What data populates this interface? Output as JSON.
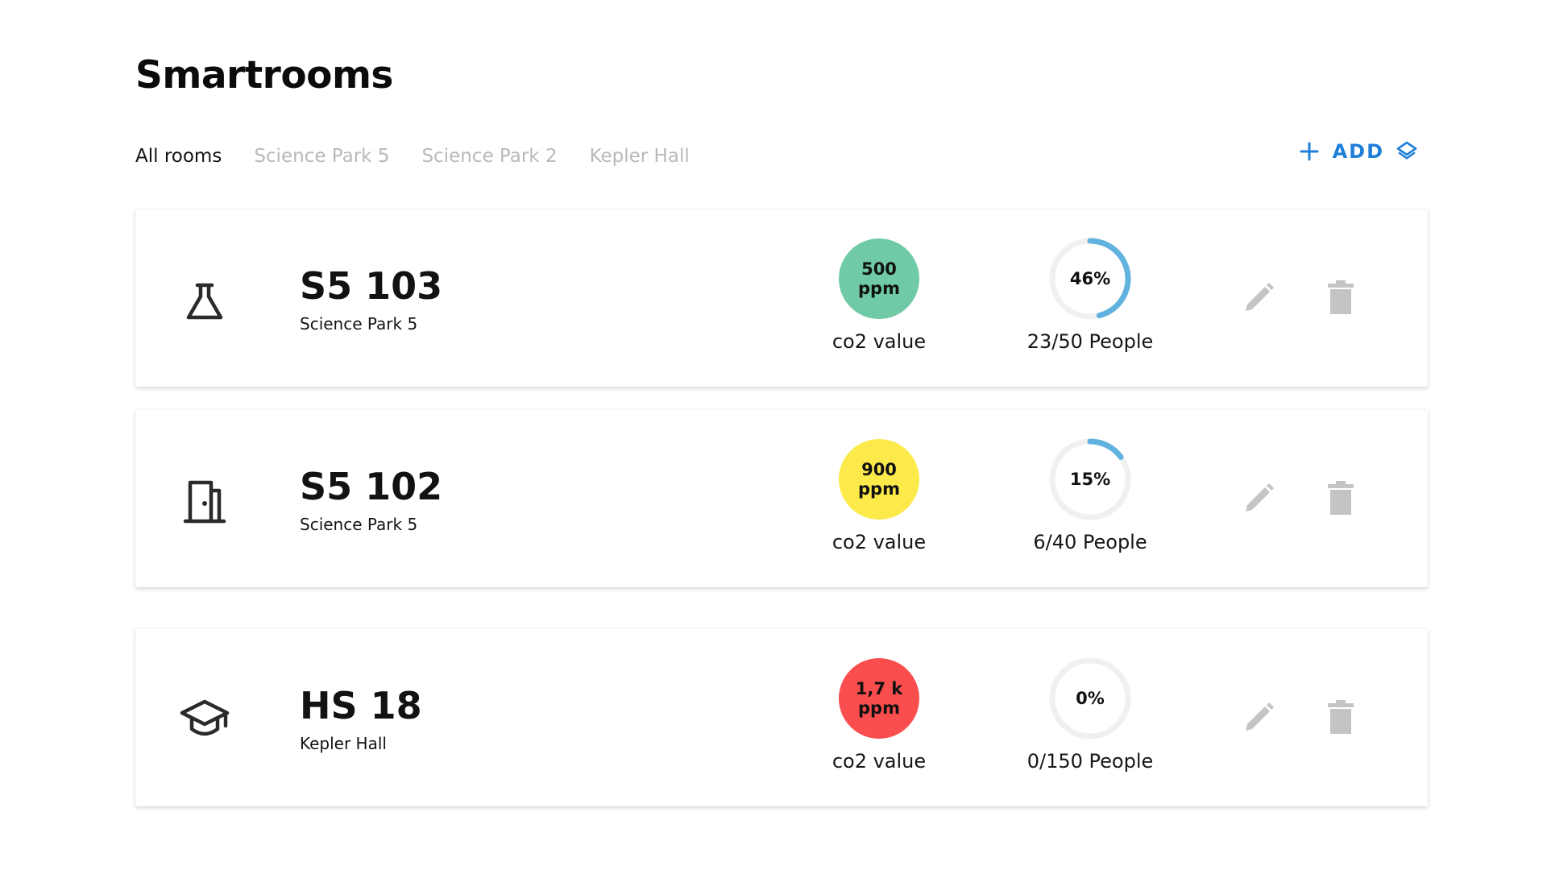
{
  "page": {
    "title": "Smartrooms"
  },
  "tabs": [
    {
      "label": "All rooms",
      "active": true
    },
    {
      "label": "Science Park 5",
      "active": false
    },
    {
      "label": "Science Park 2",
      "active": false
    },
    {
      "label": "Kepler Hall",
      "active": false
    }
  ],
  "toolbar": {
    "add_label": "ADD",
    "add_icon": "plus-icon",
    "layers_icon": "layers-icon",
    "accent_color": "#1f7fd8"
  },
  "rooms": [
    {
      "icon": "flask-icon",
      "name": "S5 103",
      "location": "Science Park 5",
      "co2": {
        "value": "500",
        "unit": "ppm",
        "label": "co2 value",
        "color": "#6fcaa5"
      },
      "occupancy": {
        "percent_text": "46%",
        "fraction": 0.46,
        "label": "23/50 People"
      },
      "actions": {
        "edit_icon": "pencil-icon",
        "delete_icon": "trash-icon"
      }
    },
    {
      "icon": "door-icon",
      "name": "S5 102",
      "location": "Science Park 5",
      "co2": {
        "value": "900",
        "unit": "ppm",
        "label": "co2 value",
        "color": "#fcea4a"
      },
      "occupancy": {
        "percent_text": "15%",
        "fraction": 0.15,
        "label": "6/40 People"
      },
      "actions": {
        "edit_icon": "pencil-icon",
        "delete_icon": "trash-icon"
      }
    },
    {
      "icon": "graduation-cap-icon",
      "name": "HS 18",
      "location": "Kepler Hall",
      "co2": {
        "value": "1,7 k",
        "unit": "ppm",
        "label": "co2 value",
        "color": "#fa4d4d"
      },
      "occupancy": {
        "percent_text": "0%",
        "fraction": 0.0,
        "label": "0/150 People"
      },
      "actions": {
        "edit_icon": "pencil-icon",
        "delete_icon": "trash-icon"
      }
    }
  ],
  "colors": {
    "gauge_track": "#f0f0f0",
    "gauge_fill": "#62b2df",
    "action_icon": "#c4c4c4"
  }
}
